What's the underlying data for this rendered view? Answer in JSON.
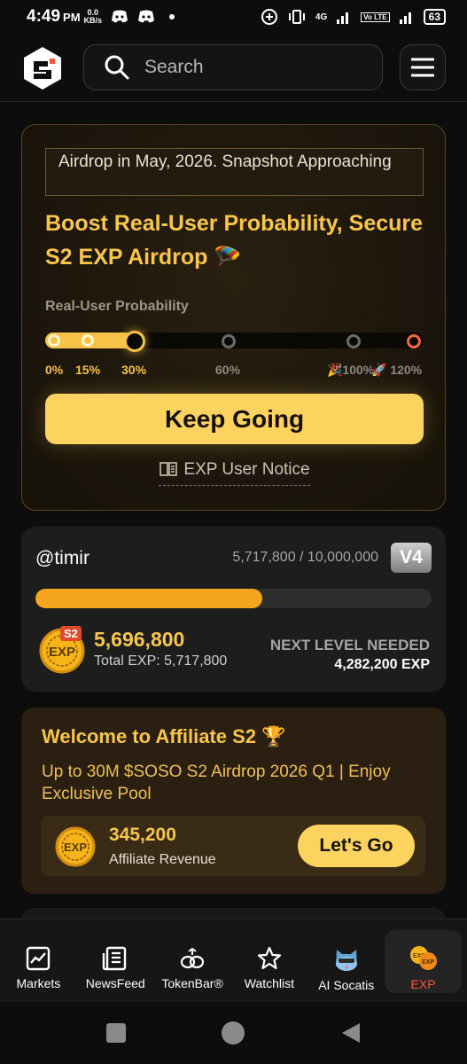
{
  "status_bar": {
    "time": "4:49",
    "ampm": "PM",
    "net_speed_value": "0.0",
    "net_speed_unit": "KB/s",
    "signal_label": "4G",
    "lte_label": "Vo LTE",
    "battery": "63"
  },
  "header": {
    "search_placeholder": "Search"
  },
  "airdrop": {
    "banner": "Airdrop in May, 2026. Snapshot Approaching",
    "title": "Boost Real-User Probability, Secure S2 EXP Airdrop 🪂",
    "probability_label": "Real-User Probability",
    "current_probability_percent": 30,
    "ticks": [
      "0%",
      "15%",
      "30%",
      "60%",
      "🎉100%",
      "🚀 120%"
    ],
    "cta_label": "Keep Going",
    "notice_label": "EXP User Notice"
  },
  "user_level": {
    "handle": "@timir",
    "progress_text": "5,717,800 / 10,000,000",
    "progress_current": 5717800,
    "progress_max": 10000000,
    "level_badge": "V4",
    "season_badge": "S2",
    "exp_value": "5,696,800",
    "total_exp": "Total EXP: 5,717,800",
    "next_level_label": "NEXT LEVEL NEEDED",
    "next_level_value": "4,282,200 EXP"
  },
  "affiliate": {
    "title": "Welcome to Affiliate S2 🏆",
    "subtitle": "Up to 30M $SOSO S2 Airdrop 2026 Q1 | Enjoy Exclusive Pool",
    "revenue_value": "345,200",
    "revenue_label": "Affiliate Revenue",
    "cta_label": "Let's Go"
  },
  "bottom_nav": {
    "items": [
      {
        "label": "Markets",
        "icon": "chart-icon"
      },
      {
        "label": "NewsFeed",
        "icon": "news-icon"
      },
      {
        "label": "TokenBar®",
        "icon": "tokenbar-icon"
      },
      {
        "label": "Watchlist",
        "icon": "star-icon"
      },
      {
        "label": "AI Socatis",
        "icon": "ai-cat-icon"
      },
      {
        "label": "EXP",
        "icon": "exp-icon",
        "active": true
      }
    ]
  },
  "colors": {
    "accent_gold": "#f8c64a",
    "button_yellow": "#fdd35f",
    "progress_orange": "#f6a61e",
    "active_nav": "#f8563a"
  }
}
